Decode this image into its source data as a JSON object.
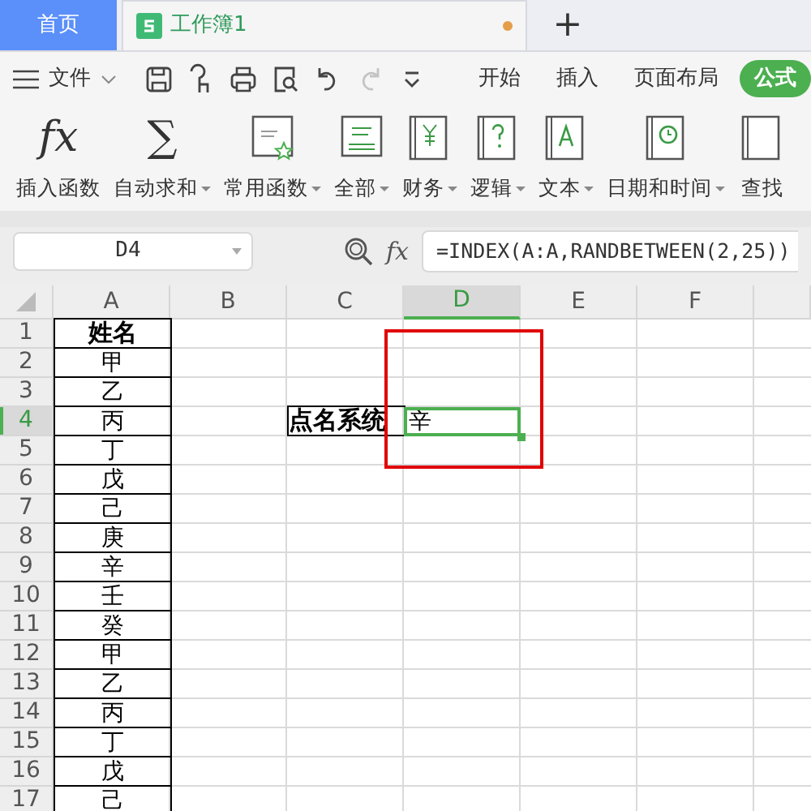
{
  "tabs": [
    {
      "kind": "home",
      "label": "首页",
      "selected": false
    },
    {
      "kind": "doc",
      "label": "工作簿1",
      "selected": true,
      "modified": true
    }
  ],
  "new_tab": "+",
  "file_menu": "文件",
  "quick_access": [
    {
      "kind": "save",
      "disabled": false
    },
    {
      "kind": "painter",
      "disabled": false
    },
    {
      "kind": "print",
      "disabled": false
    },
    {
      "kind": "preview",
      "disabled": false
    },
    {
      "kind": "undo",
      "disabled": false
    },
    {
      "kind": "redo",
      "disabled": true
    },
    {
      "kind": "more",
      "disabled": false
    }
  ],
  "ribbon_tabs": [
    {
      "label": "开始",
      "selected": false
    },
    {
      "label": "插入",
      "selected": false
    },
    {
      "label": "页面布局",
      "selected": false
    },
    {
      "label": "公式",
      "selected": true
    }
  ],
  "ribbon_buttons": [
    {
      "kind": "fx",
      "symbol": "fx",
      "label": "插入函数",
      "dropdown": false
    },
    {
      "kind": "sum",
      "symbol": "∑",
      "label": "自动求和",
      "dropdown": true
    },
    {
      "kind": "common",
      "label": "常用函数",
      "dropdown": true
    },
    {
      "kind": "all",
      "label": "全部",
      "dropdown": true
    },
    {
      "kind": "finance",
      "label": "财务",
      "dropdown": true
    },
    {
      "kind": "logic",
      "label": "逻辑",
      "dropdown": true
    },
    {
      "kind": "text",
      "label": "文本",
      "dropdown": true
    },
    {
      "kind": "date",
      "label": "日期和时间",
      "dropdown": true
    },
    {
      "kind": "lookup",
      "label": "查找",
      "dropdown": false
    }
  ],
  "name_box": "D4",
  "fx_label": "fx",
  "formula": "=INDEX(A:A,RANDBETWEEN(2,25))",
  "columns": [
    {
      "label": "A",
      "selected": false
    },
    {
      "label": "B",
      "selected": false
    },
    {
      "label": "C",
      "selected": false
    },
    {
      "label": "D",
      "selected": true
    },
    {
      "label": "E",
      "selected": false
    },
    {
      "label": "F",
      "selected": false
    }
  ],
  "rows": [
    {
      "number": "1",
      "selected": false,
      "cells": {
        "A": {
          "text": "姓名",
          "bold": true,
          "bordered": true,
          "selected": false
        }
      }
    },
    {
      "number": "2",
      "selected": false,
      "cells": {
        "A": {
          "text": "甲",
          "bold": false,
          "bordered": true,
          "selected": false
        }
      }
    },
    {
      "number": "3",
      "selected": false,
      "cells": {
        "A": {
          "text": "乙",
          "bold": false,
          "bordered": true,
          "selected": false
        }
      }
    },
    {
      "number": "4",
      "selected": true,
      "cells": {
        "A": {
          "text": "丙",
          "bold": false,
          "bordered": true,
          "selected": false
        },
        "C": {
          "text": "点名系统",
          "bold": true,
          "bordered": true,
          "selected": false
        },
        "D": {
          "text": "辛",
          "bold": false,
          "bordered": false,
          "selected": true
        }
      }
    },
    {
      "number": "5",
      "selected": false,
      "cells": {
        "A": {
          "text": "丁",
          "bold": false,
          "bordered": true,
          "selected": false
        }
      }
    },
    {
      "number": "6",
      "selected": false,
      "cells": {
        "A": {
          "text": "戊",
          "bold": false,
          "bordered": true,
          "selected": false
        }
      }
    },
    {
      "number": "7",
      "selected": false,
      "cells": {
        "A": {
          "text": "己",
          "bold": false,
          "bordered": true,
          "selected": false
        }
      }
    },
    {
      "number": "8",
      "selected": false,
      "cells": {
        "A": {
          "text": "庚",
          "bold": false,
          "bordered": true,
          "selected": false
        }
      }
    },
    {
      "number": "9",
      "selected": false,
      "cells": {
        "A": {
          "text": "辛",
          "bold": false,
          "bordered": true,
          "selected": false
        }
      }
    },
    {
      "number": "10",
      "selected": false,
      "cells": {
        "A": {
          "text": "壬",
          "bold": false,
          "bordered": true,
          "selected": false
        }
      }
    },
    {
      "number": "11",
      "selected": false,
      "cells": {
        "A": {
          "text": "癸",
          "bold": false,
          "bordered": true,
          "selected": false
        }
      }
    },
    {
      "number": "12",
      "selected": false,
      "cells": {
        "A": {
          "text": "甲",
          "bold": false,
          "bordered": true,
          "selected": false
        }
      }
    },
    {
      "number": "13",
      "selected": false,
      "cells": {
        "A": {
          "text": "乙",
          "bold": false,
          "bordered": true,
          "selected": false
        }
      }
    },
    {
      "number": "14",
      "selected": false,
      "cells": {
        "A": {
          "text": "丙",
          "bold": false,
          "bordered": true,
          "selected": false
        }
      }
    },
    {
      "number": "15",
      "selected": false,
      "cells": {
        "A": {
          "text": "丁",
          "bold": false,
          "bordered": true,
          "selected": false
        }
      }
    },
    {
      "number": "16",
      "selected": false,
      "cells": {
        "A": {
          "text": "戊",
          "bold": false,
          "bordered": true,
          "selected": false
        }
      }
    },
    {
      "number": "17",
      "selected": false,
      "cells": {
        "A": {
          "text": "己",
          "bold": false,
          "bordered": true,
          "selected": false
        }
      }
    }
  ],
  "highlight_frame": true
}
